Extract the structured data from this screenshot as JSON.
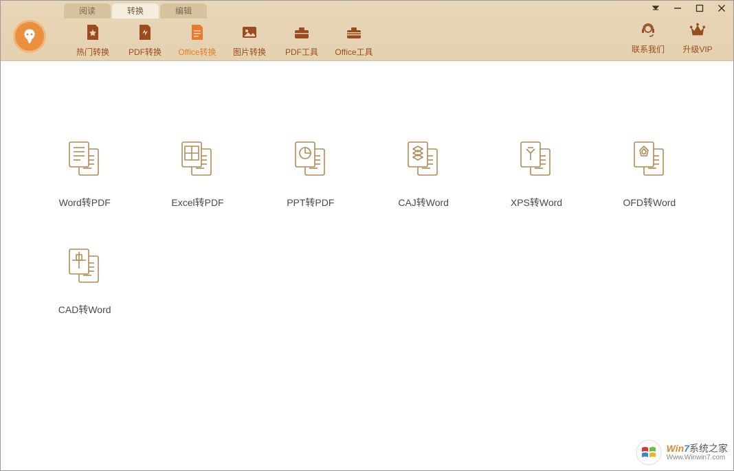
{
  "tabs": [
    {
      "label": "阅读",
      "active": false
    },
    {
      "label": "转换",
      "active": true
    },
    {
      "label": "编辑",
      "active": false
    }
  ],
  "toolbar": {
    "items": [
      {
        "name": "hot-convert",
        "label": "热门转换",
        "active": false
      },
      {
        "name": "pdf-convert",
        "label": "PDF转换",
        "active": false
      },
      {
        "name": "office-convert",
        "label": "Office转换",
        "active": true
      },
      {
        "name": "image-convert",
        "label": "图片转换",
        "active": false
      },
      {
        "name": "pdf-tools",
        "label": "PDF工具",
        "active": false
      },
      {
        "name": "office-tools",
        "label": "Office工具",
        "active": false
      }
    ]
  },
  "right_tools": {
    "contact": "联系我们",
    "upgrade": "升级VIP"
  },
  "options": [
    {
      "name": "word-to-pdf",
      "label": "Word转PDF"
    },
    {
      "name": "excel-to-pdf",
      "label": "Excel转PDF"
    },
    {
      "name": "ppt-to-pdf",
      "label": "PPT转PDF"
    },
    {
      "name": "caj-to-word",
      "label": "CAJ转Word"
    },
    {
      "name": "xps-to-word",
      "label": "XPS转Word"
    },
    {
      "name": "ofd-to-word",
      "label": "OFD转Word"
    },
    {
      "name": "cad-to-word",
      "label": "CAD转Word"
    }
  ],
  "watermark": {
    "brand_win": "Win",
    "brand_seven": "7",
    "brand_rest": "系统之家",
    "url": "Www.Winwin7.com"
  }
}
